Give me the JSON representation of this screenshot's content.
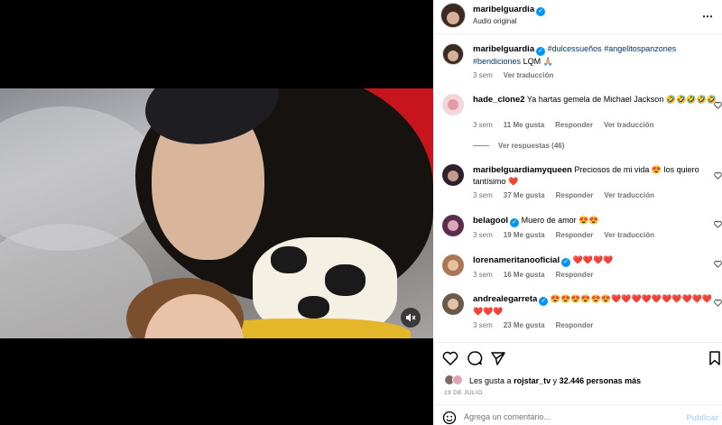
{
  "header": {
    "username": "maribelguardia",
    "subtitle": "Audio original"
  },
  "caption": {
    "username": "maribelguardia",
    "tags": [
      "#dulcessueños",
      "#angelitospanzones",
      "#bendiciones"
    ],
    "text_end": "LQM 🙏🏼",
    "time": "3 sem",
    "translate": "Ver traducción"
  },
  "comments": [
    {
      "username": "hade_clone2",
      "text": "Ya hartas gemela de Michael Jackson 🤣🤣🤣🤣🤣",
      "time": "3 sem",
      "likes": "11 Me gusta",
      "reply": "Responder",
      "translate": "Ver traducción",
      "replies": "Ver respuestas (46)"
    },
    {
      "username": "maribelguardiamyqueen",
      "text": "Preciosos de mi vida 😍 los quiero tantísimo ❤️",
      "time": "3 sem",
      "likes": "37 Me gusta",
      "reply": "Responder",
      "translate": "Ver traducción"
    },
    {
      "username": "belagool",
      "verified": true,
      "text": "Muero de amor 😍😍",
      "time": "3 sem",
      "likes": "19 Me gusta",
      "reply": "Responder",
      "translate": "Ver traducción"
    },
    {
      "username": "lorenameritanooficial",
      "verified": true,
      "text": "❤️❤️❤️❤️",
      "time": "3 sem",
      "likes": "16 Me gusta",
      "reply": "Responder"
    },
    {
      "username": "andrealegarreta",
      "verified": true,
      "text": "😍😍😍😍😍😍❤️❤️❤️❤️❤️❤️❤️❤️❤️❤️❤️❤️❤️",
      "time": "3 sem",
      "likes": "23 Me gusta",
      "reply": "Responder"
    }
  ],
  "likes_line": {
    "prefix": "Les gusta a",
    "user": "rojstar_tv",
    "middle": "y",
    "count": "32.446 personas más"
  },
  "date": "19 DE JULIO",
  "add_comment": {
    "placeholder": "Agrega un comentario...",
    "publish": "Publicar"
  },
  "icons": [
    "heart-icon",
    "comment-icon",
    "share-icon",
    "bookmark-icon",
    "mute-icon",
    "more-icon",
    "emoji-icon",
    "verified-icon"
  ],
  "colors": {
    "verified": "#0095f6",
    "hashtag": "#00376b",
    "secondary_text": "#737373",
    "publish": "#b3dbff"
  }
}
